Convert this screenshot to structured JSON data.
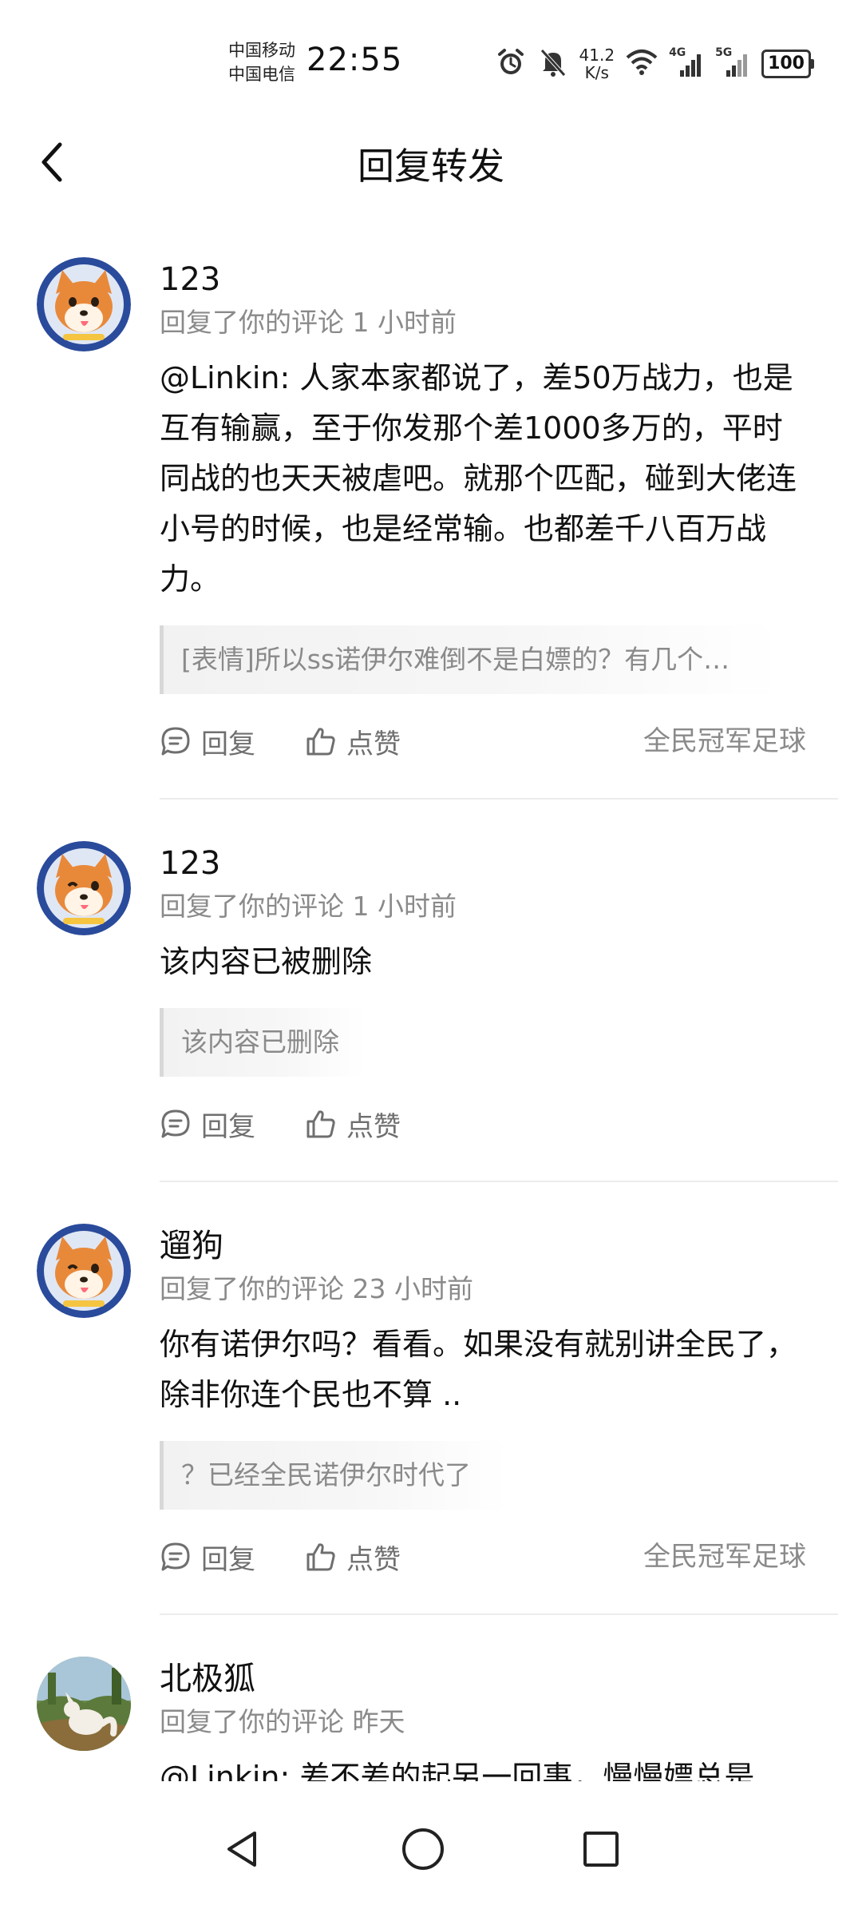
{
  "status_bar": {
    "carrier_1": "中国移动",
    "carrier_2": "中国电信",
    "time": "22:55",
    "net_speed_value": "41.2",
    "net_speed_unit": "K/s",
    "signal_1_label": "4G",
    "signal_2_label": "5G",
    "battery": "100"
  },
  "header": {
    "title": "回复转发"
  },
  "items": [
    {
      "username": "123",
      "meta": "回复了你的评论 1 小时前",
      "content": "@Linkin: 人家本家都说了，差50万战力，也是互有输赢，至于你发那个差1000多万的，平时同战的也天天被虐吧。就那个匹配，碰到大佬连小号的时候，也是经常输。也都差千八百万战力。",
      "quote": "[表情]所以ss诺伊尔难倒不是白嫖的？有几个…",
      "reply_label": "回复",
      "like_label": "点赞",
      "source": "全民冠军足球"
    },
    {
      "username": "123",
      "meta": "回复了你的评论 1 小时前",
      "content": "该内容已被删除",
      "quote": "该内容已删除",
      "reply_label": "回复",
      "like_label": "点赞",
      "source": ""
    },
    {
      "username": "遛狗",
      "meta": "回复了你的评论 23 小时前",
      "content": "你有诺伊尔吗？看看。如果没有就别讲全民了，除非你连个民也不算 ..",
      "quote": "？已经全民诺伊尔时代了",
      "reply_label": "回复",
      "like_label": "点赞",
      "source": "全民冠军足球"
    },
    {
      "username": "北极狐",
      "meta": "回复了你的评论 昨天",
      "content": "@Linkin: 差不差的起另一回事，慢慢嫖总是"
    }
  ],
  "colors": {
    "text_primary": "#111111",
    "text_secondary": "#8a8a8a",
    "action_text": "#6f6f6f",
    "divider": "#ececec",
    "quote_bg": "#f2f2f2",
    "avatar_ring": "#2a4b9b",
    "shiba_orange": "#e8893a"
  },
  "icons": {
    "back": "chevron-left-icon",
    "reply": "comment-bubble-icon",
    "like": "thumbs-up-icon",
    "alarm": "alarm-icon",
    "mute": "bell-off-icon",
    "wifi": "wifi-icon",
    "nav_back": "triangle-back-icon",
    "nav_home": "circle-home-icon",
    "nav_recent": "square-recents-icon"
  }
}
